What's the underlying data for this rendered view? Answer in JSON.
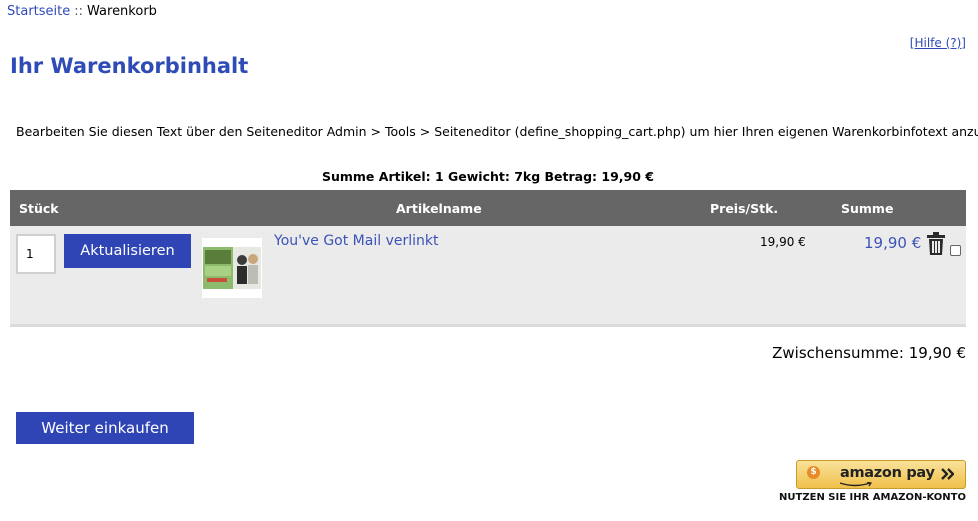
{
  "breadcrumb": {
    "home": "Startseite",
    "separator": "::",
    "current": "Warenkorb"
  },
  "help_link": "[Hilfe (?)]",
  "page_title": "Ihr Warenkorbinhalt",
  "info_text": "Bearbeiten Sie diesen Text über den Seiteneditor Admin > Tools > Seiteneditor (define_shopping_cart.php) um hier Ihren eigenen Warenkorbinfotext anzuzeigen",
  "cart_summary": "Summe Artikel: 1  Gewicht: 7kg  Betrag: 19,90 €",
  "table": {
    "headers": {
      "quantity": "Stück",
      "product": "Artikelname",
      "unit_price": "Preis/Stk.",
      "total": "Summe"
    },
    "rows": [
      {
        "quantity": "1",
        "update_label": "Aktualisieren",
        "product_name": "You've Got Mail verlinkt",
        "unit_price": "19,90 €",
        "total": "19,90 €"
      }
    ]
  },
  "subtotal": "Zwischensumme: 19,90 €",
  "continue_shopping": "Weiter einkaufen",
  "amazon_pay": {
    "label": "amazon pay",
    "note": "NUTZEN SIE IHR AMAZON-KONTO"
  },
  "colors": {
    "accent": "#3045b5",
    "link": "#2f4bb5",
    "table_header": "#666666",
    "row_background": "#ebebeb",
    "amazon_button": "#f0c04a"
  },
  "icons": {
    "trash": "trash-icon",
    "amazon_pay_badge": "amazon-pay-icon",
    "amazon_arrow": "chevron-double-right-icon"
  }
}
